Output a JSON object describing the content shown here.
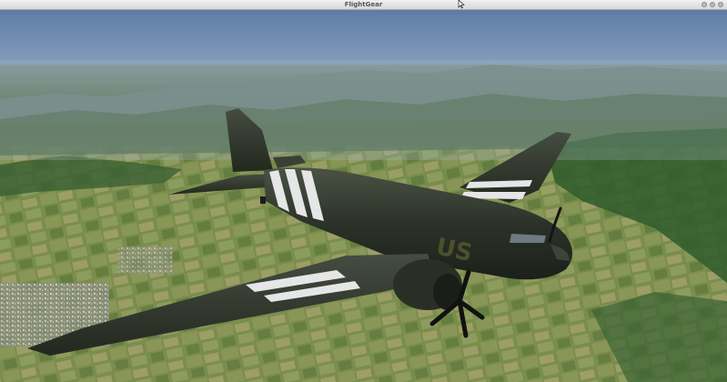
{
  "window": {
    "title": "FlightGear"
  },
  "scene": {
    "aircraft_marking": "US"
  },
  "icons": {
    "window_buttons": [
      "minimize-icon",
      "maximize-icon",
      "close-icon"
    ],
    "cursor": "mouse-pointer-icon"
  },
  "colors": {
    "sky_top": "#5f7ea8",
    "haze": "#a9b7c8",
    "terrain": "#7a8c4e",
    "forest": "#2f5a2a",
    "fuselage": "#2b3228",
    "stripe": "#e6e6e6"
  }
}
